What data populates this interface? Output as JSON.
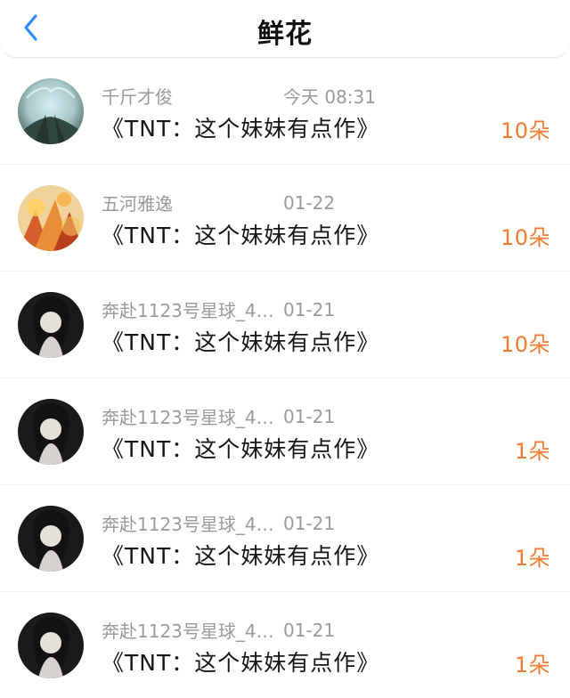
{
  "header": {
    "title": "鲜花",
    "back_icon": "chevron-left-icon",
    "accent": "#2f8cff"
  },
  "list": [
    {
      "user": "千斤才俊",
      "time": "今天 08:31",
      "book": "《TNT：这个妹妹有点作》",
      "count": "10朵",
      "avatar_kind": "landscape-1"
    },
    {
      "user": "五河雅逸",
      "time": "01-22",
      "book": "《TNT：这个妹妹有点作》",
      "count": "10朵",
      "avatar_kind": "autumn-leaves"
    },
    {
      "user": "奔赴1123号星球_4…",
      "time": "01-21",
      "book": "《TNT：这个妹妹有点作》",
      "count": "10朵",
      "avatar_kind": "portrait"
    },
    {
      "user": "奔赴1123号星球_4…",
      "time": "01-21",
      "book": "《TNT：这个妹妹有点作》",
      "count": "1朵",
      "avatar_kind": "portrait"
    },
    {
      "user": "奔赴1123号星球_4…",
      "time": "01-21",
      "book": "《TNT：这个妹妹有点作》",
      "count": "1朵",
      "avatar_kind": "portrait"
    },
    {
      "user": "奔赴1123号星球_4…",
      "time": "01-21",
      "book": "《TNT：这个妹妹有点作》",
      "count": "1朵",
      "avatar_kind": "portrait"
    }
  ],
  "colors": {
    "count": "#f07c34",
    "meta": "#9a9a9a",
    "title": "#111111"
  }
}
